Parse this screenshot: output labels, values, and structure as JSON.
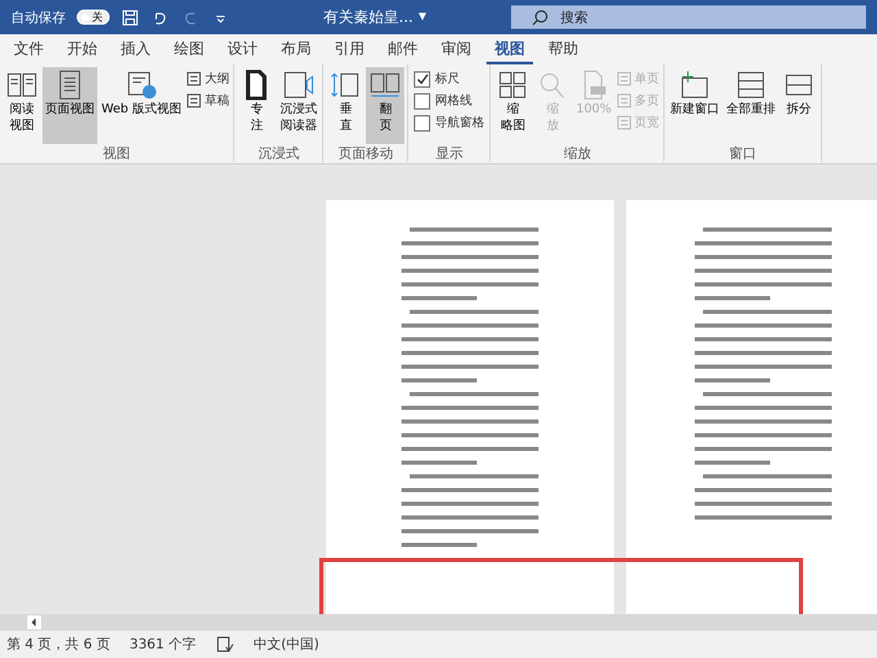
{
  "title_bar": {
    "autosave_label": "自动保存",
    "autosave_on": false,
    "autosave_state": "关",
    "document_title": "有关秦始皇...",
    "title_caret": "▾",
    "search_placeholder": "搜索"
  },
  "tabs": [
    {
      "label": "文件",
      "selected": false
    },
    {
      "label": "开始",
      "selected": false
    },
    {
      "label": "插入",
      "selected": false
    },
    {
      "label": "绘图",
      "selected": false
    },
    {
      "label": "设计",
      "selected": false
    },
    {
      "label": "布局",
      "selected": false
    },
    {
      "label": "引用",
      "selected": false
    },
    {
      "label": "邮件",
      "selected": false
    },
    {
      "label": "审阅",
      "selected": false
    },
    {
      "label": "视图",
      "selected": true
    },
    {
      "label": "帮助",
      "selected": false
    }
  ],
  "ribbon": [
    {
      "label": "视图",
      "items": [
        {
          "kind": "large",
          "lines": [
            "阅读",
            "视图"
          ],
          "selected": false,
          "disabled": false
        },
        {
          "kind": "large",
          "lines": [
            "页面视图"
          ],
          "selected": true,
          "disabled": false
        },
        {
          "kind": "large",
          "lines": [
            "Web 版式视图"
          ],
          "selected": false,
          "disabled": false
        },
        {
          "kind": "stack",
          "items": [
            {
              "kind": "small",
              "label": "大纲",
              "disabled": false
            },
            {
              "kind": "small",
              "label": "草稿",
              "disabled": false
            }
          ]
        }
      ]
    },
    {
      "label": "沉浸式",
      "items": [
        {
          "kind": "large",
          "lines": [
            "专",
            "注"
          ],
          "selected": false,
          "disabled": false
        },
        {
          "kind": "large",
          "lines": [
            "沉浸式",
            "阅读器"
          ],
          "selected": false,
          "disabled": false
        }
      ]
    },
    {
      "label": "页面移动",
      "items": [
        {
          "kind": "large",
          "lines": [
            "垂",
            "直"
          ],
          "selected": false,
          "disabled": false
        },
        {
          "kind": "large",
          "lines": [
            "翻",
            "页"
          ],
          "selected": true,
          "disabled": false
        }
      ]
    },
    {
      "label": "显示",
      "items": [
        {
          "kind": "stack",
          "items": [
            {
              "kind": "check",
              "label": "标尺",
              "checked": true
            },
            {
              "kind": "check",
              "label": "网格线",
              "checked": false
            },
            {
              "kind": "check",
              "label": "导航窗格",
              "checked": false
            }
          ]
        }
      ]
    },
    {
      "label": "缩放",
      "items": [
        {
          "kind": "large",
          "lines": [
            "缩",
            "略图"
          ],
          "selected": false,
          "disabled": false
        },
        {
          "kind": "large",
          "lines": [
            "缩",
            "放"
          ],
          "selected": false,
          "disabled": true
        },
        {
          "kind": "large",
          "lines": [
            "100%"
          ],
          "selected": false,
          "disabled": true
        },
        {
          "kind": "stack",
          "items": [
            {
              "kind": "small",
              "label": "单页",
              "disabled": true
            },
            {
              "kind": "small",
              "label": "多页",
              "disabled": true
            },
            {
              "kind": "small",
              "label": "页宽",
              "disabled": true
            }
          ]
        }
      ]
    },
    {
      "label": "窗口",
      "items": [
        {
          "kind": "large",
          "lines": [
            "新建窗口"
          ],
          "selected": false,
          "disabled": false
        },
        {
          "kind": "large",
          "lines": [
            "全部重排"
          ],
          "selected": false,
          "disabled": false
        },
        {
          "kind": "large",
          "lines": [
            "拆分"
          ],
          "selected": false,
          "disabled": false
        }
      ]
    }
  ],
  "status_bar": {
    "page": "第 4 页，共 6 页",
    "words": "3361 个字",
    "language": "中文(中国)"
  }
}
